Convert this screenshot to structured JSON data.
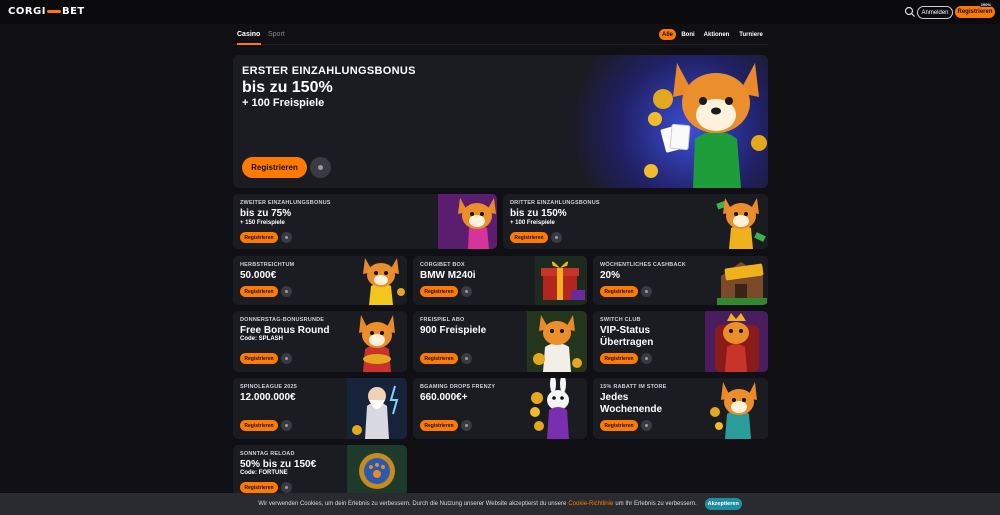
{
  "header": {
    "logo_left": "CORGI",
    "logo_right": "BET",
    "login_label": "Anmelden",
    "register_label": "Registrieren",
    "register_badge": "100%"
  },
  "tabs": [
    {
      "label": "Casino",
      "active": true
    },
    {
      "label": "Sport",
      "active": false
    }
  ],
  "filters": [
    {
      "label": "Alle",
      "active": true
    },
    {
      "label": "Boni",
      "active": false
    },
    {
      "label": "Aktionen",
      "active": false
    },
    {
      "label": "Turniere",
      "active": false
    }
  ],
  "hero": {
    "kicker": "ERSTER EINZAHLUNGSBONUS",
    "title": "bis zu 150%",
    "subtitle": "+ 100 Freispiele",
    "button_label": "Registrieren"
  },
  "promos": {
    "p1": {
      "kicker": "ZWEITER EINZAHLUNGSBONUS",
      "title": "bis zu 75%",
      "extra": "+ 150 Freispiele",
      "button": "Registrieren"
    },
    "p2": {
      "kicker": "DRITTER EINZAHLUNGSBONUS",
      "title": "bis zu 150%",
      "extra": "+ 100 Freispiele",
      "button": "Registrieren"
    },
    "p3": {
      "kicker": "HERBSTREICHTUM",
      "title": "50.000€",
      "button": "Registrieren"
    },
    "p4": {
      "kicker": "CORGIBET BOX",
      "title": "BMW M240i",
      "button": "Registrieren"
    },
    "p5": {
      "kicker": "WÖCHENTLICHES CASHBACK",
      "title": "20%",
      "button": "Registrieren"
    },
    "p6": {
      "kicker": "DONNERSTAG-BONUSRUNDE",
      "title": "Free Bonus Round",
      "extra": "Code: SPLASH",
      "button": "Registrieren"
    },
    "p7": {
      "kicker": "FREISPIEL ABO",
      "title": "900 Freispiele",
      "button": "Registrieren"
    },
    "p8": {
      "kicker": "SWITCH CLUB",
      "title_line1": "VIP-Status",
      "title_line2": "Übertragen",
      "button": "Registrieren"
    },
    "p9": {
      "kicker": "SPINOLEAGUE 2025",
      "title": "12.000.000€",
      "button": "Registrieren"
    },
    "p10": {
      "kicker": "BGAMING DROPS FRENZY",
      "title": "660.000€+",
      "button": "Registrieren"
    },
    "p11": {
      "kicker": "15% RABATT IM STORE",
      "title_line1": "Jedes",
      "title_line2": "Wochenende",
      "button": "Registrieren"
    },
    "p12": {
      "kicker": "SONNTAG RELOAD",
      "title": "50% bis zu 150€",
      "extra": "Code: FORTUNE",
      "button": "Registrieren"
    }
  },
  "cookie": {
    "text_before": "Wir verwenden Cookies, um dein Erlebnis zu verbessern. Durch die Nutzung unserer Website akzeptierst du unsere",
    "link": "Cookie-Richtlinie",
    "text_after": "um Ihr Erlebnis zu verbessern.",
    "accept_label": "Akzeptieren"
  },
  "colors": {
    "accent": "#ff7a00",
    "card_bg": "#1b1b22",
    "page_bg": "#101014",
    "cookie_button": "#1e8fa0"
  }
}
